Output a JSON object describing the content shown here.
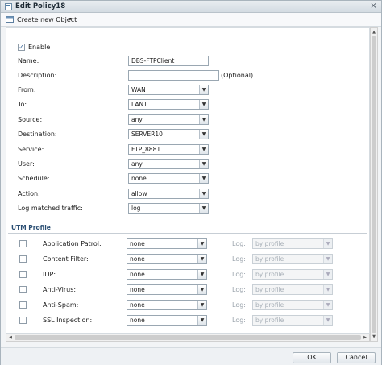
{
  "window": {
    "title": "Edit Policy18",
    "close_glyph": "×"
  },
  "toolbar": {
    "create_label": "Create new Object",
    "caret": "▾"
  },
  "enable": {
    "label": "Enable",
    "checked": true
  },
  "fields": {
    "name": {
      "label": "Name:",
      "value": "DBS-FTPClient"
    },
    "description": {
      "label": "Description:",
      "value": "",
      "hint": "(Optional)"
    },
    "from": {
      "label": "From:",
      "value": "WAN"
    },
    "to": {
      "label": "To:",
      "value": "LAN1"
    },
    "source": {
      "label": "Source:",
      "value": "any"
    },
    "destination": {
      "label": "Destination:",
      "value": "SERVER10"
    },
    "service": {
      "label": "Service:",
      "value": "FTP_8881"
    },
    "user": {
      "label": "User:",
      "value": "any"
    },
    "schedule": {
      "label": "Schedule:",
      "value": "none"
    },
    "action": {
      "label": "Action:",
      "value": "allow"
    },
    "log": {
      "label": "Log matched traffic:",
      "value": "log"
    }
  },
  "utm": {
    "section_title": "UTM Profile",
    "log_label": "Log:",
    "rows": [
      {
        "label": "Application Patrol:",
        "value": "none",
        "log": "by profile"
      },
      {
        "label": "Content Filter:",
        "value": "none",
        "log": "by profile"
      },
      {
        "label": "IDP:",
        "value": "none",
        "log": "by profile"
      },
      {
        "label": "Anti-Virus:",
        "value": "none",
        "log": "by profile"
      },
      {
        "label": "Anti-Spam:",
        "value": "none",
        "log": "by profile"
      },
      {
        "label": "SSL Inspection:",
        "value": "none",
        "log": "by profile"
      }
    ]
  },
  "buttons": {
    "ok": "OK",
    "cancel": "Cancel"
  },
  "glyphs": {
    "dropdown": "▼",
    "check": "✓",
    "up": "▲",
    "down": "▼",
    "left": "◀",
    "right": "▶"
  }
}
